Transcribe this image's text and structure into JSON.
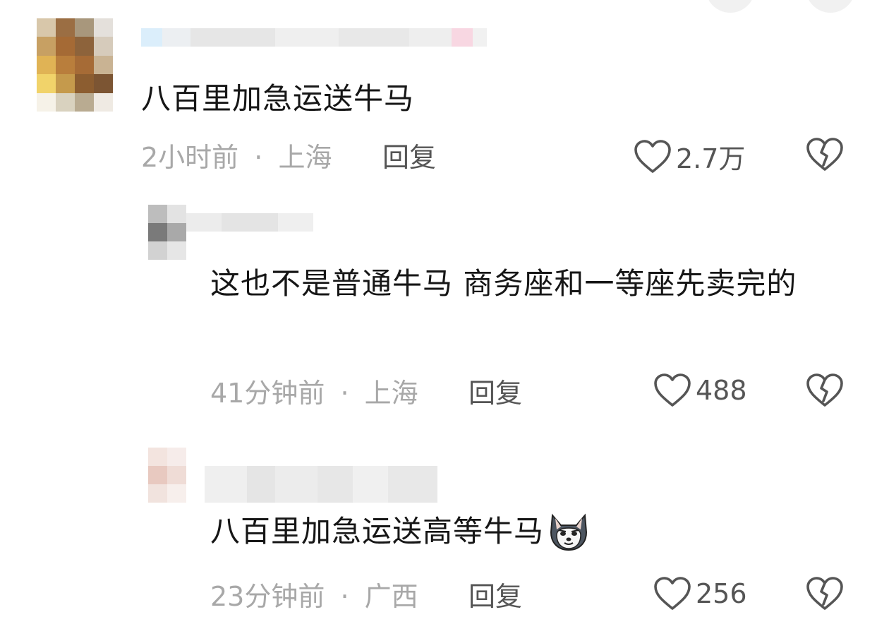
{
  "comments": [
    {
      "text": "八百里加急运送牛马",
      "time": "2小时前",
      "separator": "·",
      "location": "上海",
      "reply_label": "回复",
      "likes": "2.7万",
      "username_blurred": true
    },
    {
      "text": "这也不是普通牛马  商务座和一等座先卖完的",
      "time": "41分钟前",
      "separator": "·",
      "location": "上海",
      "reply_label": "回复",
      "likes": "488",
      "username_blurred": true
    },
    {
      "text": "八百里加急运送高等牛马",
      "emoji": "wolf-dog-face",
      "time": "23分钟前",
      "separator": "·",
      "location": "广西",
      "reply_label": "回复",
      "likes": "256",
      "username_blurred": true
    }
  ],
  "icons": {
    "like": "heart-outline-icon",
    "dislike": "broken-heart-icon"
  },
  "colors": {
    "meta": "#a8a8a8",
    "text": "#161616",
    "action": "#555555"
  }
}
